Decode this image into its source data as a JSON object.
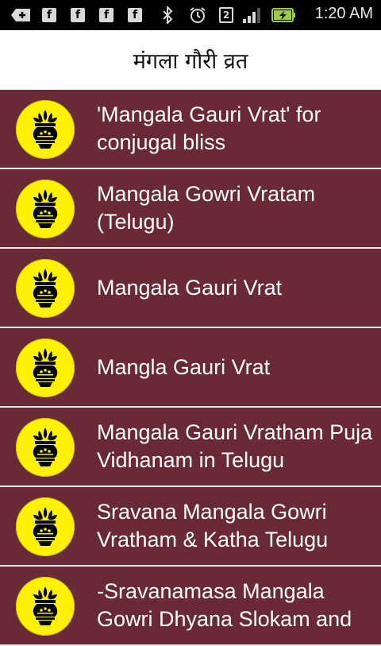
{
  "status_bar": {
    "time": "1:20 AM",
    "notification_badge": "2",
    "icons": [
      "add-icon",
      "facebook-icon",
      "facebook-icon",
      "facebook-icon",
      "facebook-icon",
      "bluetooth-icon",
      "alarm-icon",
      "sim-icon",
      "signal-icon",
      "battery-charging-icon"
    ]
  },
  "header": {
    "title": "मंगला गौरी व्रत"
  },
  "colors": {
    "row_background": "#6a2a35",
    "icon_background": "#fff200",
    "header_background": "#ffffff"
  },
  "list": {
    "items": [
      {
        "label": "'Mangala Gauri Vrat' for conjugal bliss",
        "icon": "kalash-icon"
      },
      {
        "label": "Mangala Gowri Vratam (Telugu)",
        "icon": "kalash-icon"
      },
      {
        "label": "Mangala Gauri Vrat",
        "icon": "kalash-icon"
      },
      {
        "label": "Mangla Gauri Vrat",
        "icon": "kalash-icon"
      },
      {
        "label": "Mangala Gauri Vratham Puja Vidhanam in Telugu",
        "icon": "kalash-icon"
      },
      {
        "label": "Sravana Mangala Gowri Vratham & Katha Telugu",
        "icon": "kalash-icon"
      },
      {
        "label": "-Sravanamasa Mangala Gowri Dhyana Slokam and",
        "icon": "kalash-icon"
      }
    ]
  }
}
